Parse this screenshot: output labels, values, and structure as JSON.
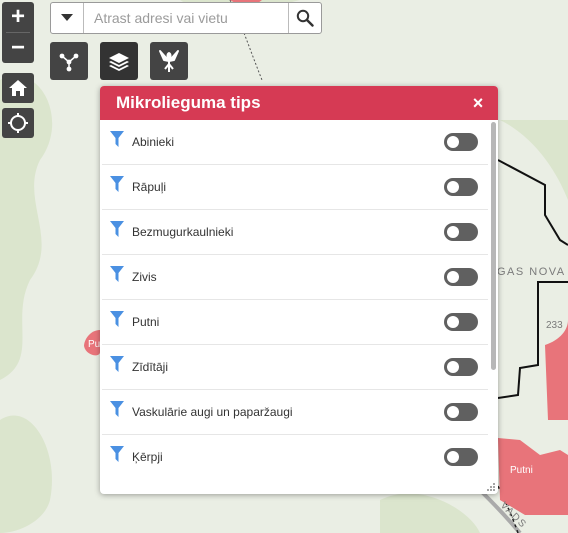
{
  "search": {
    "placeholder": "Atrast adresi vai vietu"
  },
  "zoom": {
    "in_label": "+",
    "out_label": "−"
  },
  "map": {
    "labels": {
      "region": "GAS NOVA",
      "elevation": "233",
      "putni_poly": "Putni",
      "left_poly": "Pu",
      "road": "VADS"
    },
    "colors": {
      "base": "#eaeee4",
      "hill": "#d9e4cc",
      "habitat": "#e8747a",
      "boundary": "#111111"
    }
  },
  "panel": {
    "title": "Mikrolieguma tips",
    "close_label": "×",
    "items": [
      {
        "label": "Abinieki",
        "enabled": false
      },
      {
        "label": "Rāpuļi",
        "enabled": false
      },
      {
        "label": "Bezmugurkaulnieki",
        "enabled": false
      },
      {
        "label": "Zivis",
        "enabled": false
      },
      {
        "label": "Putni",
        "enabled": false
      },
      {
        "label": "Zīdītāji",
        "enabled": false
      },
      {
        "label": "Vaskulārie augi un paparžaugi",
        "enabled": false
      },
      {
        "label": "Ķērpji",
        "enabled": false
      }
    ]
  },
  "colors": {
    "header": "#d63a54",
    "filter_icon": "#4a90e2",
    "toggle_off": "#606060",
    "control_bg": "#444444"
  }
}
